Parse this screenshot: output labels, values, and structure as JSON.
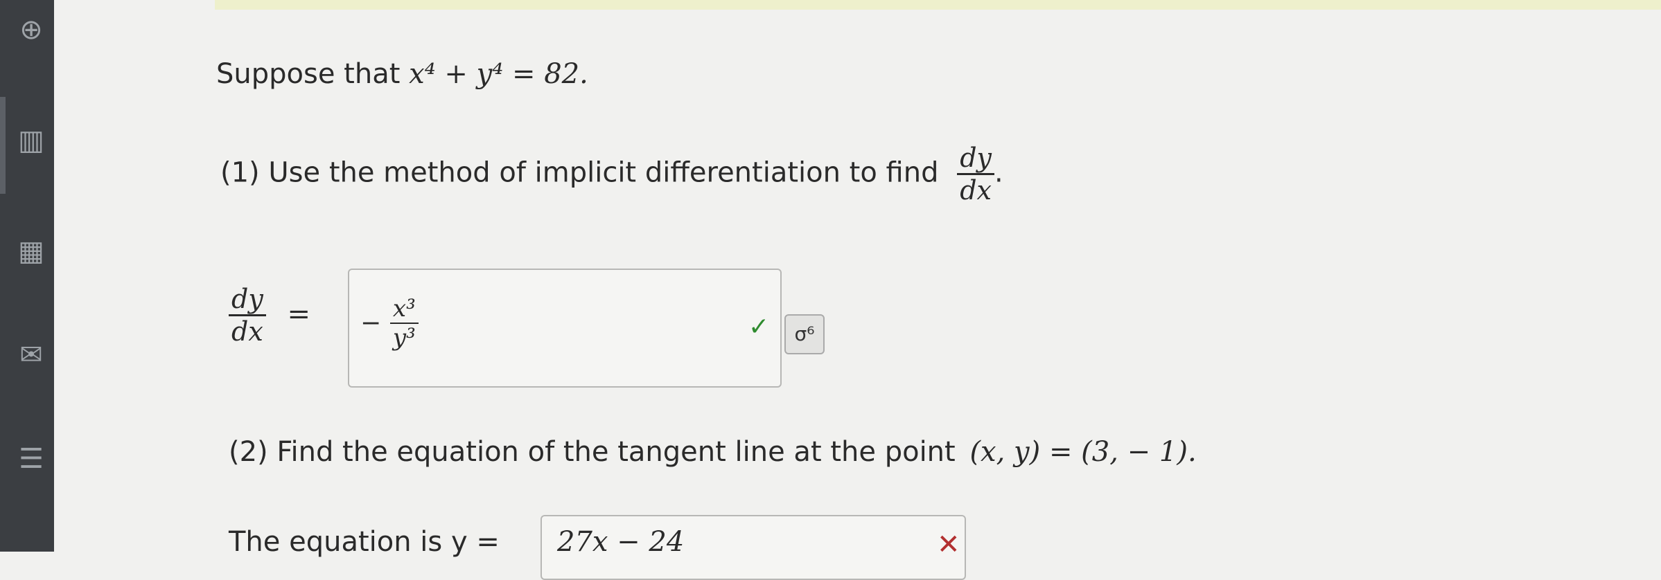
{
  "sidebar": {
    "icons": [
      "globe-icon",
      "book-icon",
      "calendar-icon",
      "mail-icon",
      "list-icon"
    ]
  },
  "problem": {
    "intro_text": "Suppose that",
    "equation": "x⁴ + y⁴ = 82.",
    "part1_prefix": "(1) Use the method of implicit differentiation to find",
    "dy": "dy",
    "dx": "dx",
    "period": ".",
    "equals": "=",
    "part2_text": "(2) Find the equation of the tangent line at the point",
    "point": "(x, y) = (3, − 1).",
    "eq_label": "The equation is y =",
    "eq_answer": "27x − 24"
  },
  "answer1": {
    "neg": "−",
    "num": "x³",
    "den": "y³"
  },
  "status": {
    "check": "✓",
    "cross": "✕",
    "symbol_button": "σ⁶"
  }
}
